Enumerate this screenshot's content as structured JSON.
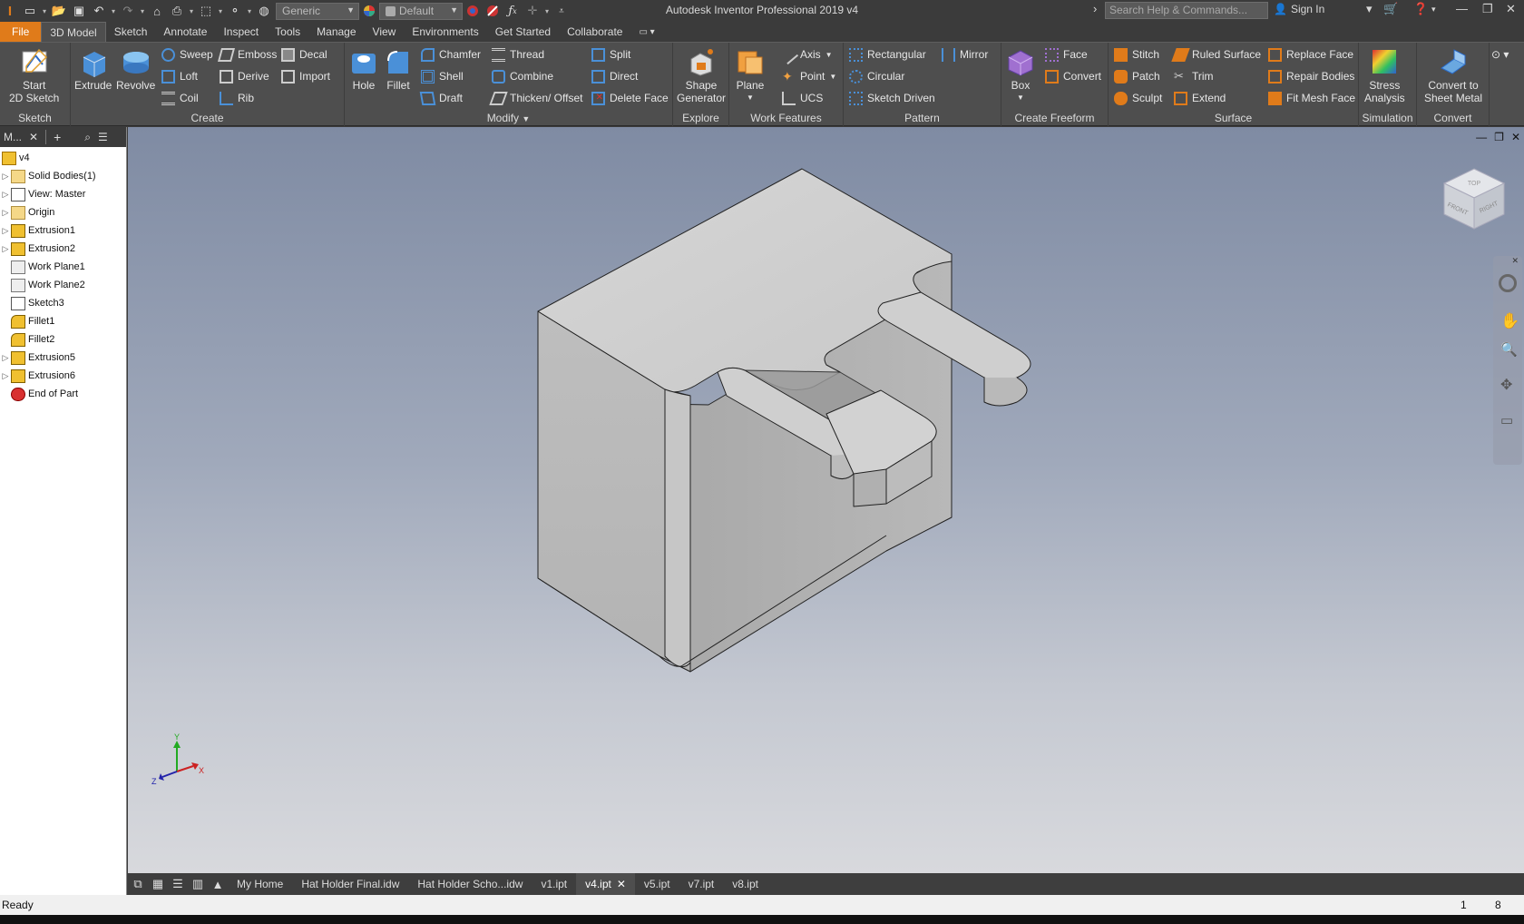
{
  "app_title": "Autodesk Inventor Professional 2019    v4",
  "quick_access": {
    "material": "Generic",
    "appearance": "Default"
  },
  "search": {
    "placeholder": "Search Help & Commands..."
  },
  "signin": "Sign In",
  "menu_tabs": [
    "File",
    "3D Model",
    "Sketch",
    "Annotate",
    "Inspect",
    "Tools",
    "Manage",
    "View",
    "Environments",
    "Get Started",
    "Collaborate"
  ],
  "ribbon": {
    "sketch": {
      "title": "Sketch",
      "start_2d_sketch": "Start\n2D Sketch"
    },
    "create": {
      "title": "Create",
      "extrude": "Extrude",
      "revolve": "Revolve",
      "sweep": "Sweep",
      "loft": "Loft",
      "coil": "Coil",
      "emboss": "Emboss",
      "derive": "Derive",
      "rib": "Rib",
      "decal": "Decal",
      "import": "Import"
    },
    "modify": {
      "title": "Modify",
      "hole": "Hole",
      "fillet": "Fillet",
      "chamfer": "Chamfer",
      "shell": "Shell",
      "draft": "Draft",
      "thread": "Thread",
      "combine": "Combine",
      "thicken_offset": "Thicken/ Offset",
      "split": "Split",
      "direct": "Direct",
      "delete_face": "Delete Face"
    },
    "explore": {
      "title": "Explore",
      "shape_generator": "Shape\nGenerator"
    },
    "work_features": {
      "title": "Work Features",
      "plane": "Plane",
      "axis": "Axis",
      "point": "Point",
      "ucs": "UCS"
    },
    "pattern": {
      "title": "Pattern",
      "rectangular": "Rectangular",
      "circular": "Circular",
      "sketch_driven": "Sketch Driven",
      "mirror": "Mirror"
    },
    "freeform": {
      "title": "Create Freeform",
      "box": "Box",
      "face": "Face",
      "convert": "Convert"
    },
    "surface": {
      "title": "Surface",
      "stitch": "Stitch",
      "patch": "Patch",
      "sculpt": "Sculpt",
      "ruled_surface": "Ruled Surface",
      "trim": "Trim",
      "extend": "Extend",
      "replace_face": "Replace Face",
      "repair_bodies": "Repair Bodies",
      "fit_mesh_face": "Fit Mesh Face"
    },
    "simulation": {
      "title": "Simulation",
      "stress_analysis": "Stress\nAnalysis"
    },
    "convert": {
      "title": "Convert",
      "sheet_metal": "Convert to\nSheet Metal"
    }
  },
  "browser": {
    "title": "M...",
    "nodes": [
      {
        "label": "v4",
        "icon": "part-icon"
      },
      {
        "label": "Solid Bodies(1)",
        "icon": "folder-icon"
      },
      {
        "label": "View: Master",
        "icon": "view-icon"
      },
      {
        "label": "Origin",
        "icon": "folder-icon"
      },
      {
        "label": "Extrusion1",
        "icon": "extrusion-icon"
      },
      {
        "label": "Extrusion2",
        "icon": "extrusion-icon"
      },
      {
        "label": "Work Plane1",
        "icon": "workplane-icon"
      },
      {
        "label": "Work Plane2",
        "icon": "workplane-icon"
      },
      {
        "label": "Sketch3",
        "icon": "sketch-icon"
      },
      {
        "label": "Fillet1",
        "icon": "fillet-icon"
      },
      {
        "label": "Fillet2",
        "icon": "fillet-icon"
      },
      {
        "label": "Extrusion5",
        "icon": "extrusion-icon"
      },
      {
        "label": "Extrusion6",
        "icon": "extrusion-icon"
      },
      {
        "label": "End of Part",
        "icon": "end-of-part-icon"
      }
    ]
  },
  "viewcube": {
    "top": "TOP",
    "front": "FRONT",
    "right": "RIGHT"
  },
  "doc_tabs": [
    "My Home",
    "Hat Holder Final.idw",
    "Hat Holder Scho...idw",
    "v1.ipt",
    "v4.ipt",
    "v5.ipt",
    "v7.ipt",
    "v8.ipt"
  ],
  "active_doc_tab": "v4.ipt",
  "status": {
    "text": "Ready",
    "num1": "1",
    "num2": "8"
  },
  "triad": {
    "x": "X",
    "y": "Y",
    "z": "Z"
  }
}
